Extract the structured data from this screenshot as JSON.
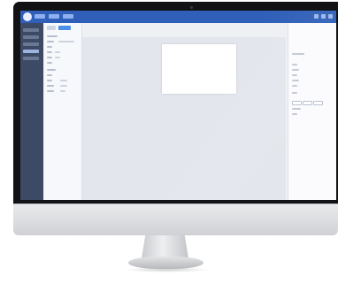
{
  "window": {
    "title": "",
    "tabs": [
      {
        "label": ""
      },
      {
        "label": ""
      },
      {
        "label": ""
      }
    ]
  },
  "sidebar": {
    "items": [
      {
        "label": ""
      },
      {
        "label": ""
      },
      {
        "label": ""
      },
      {
        "label": ""
      },
      {
        "label": ""
      }
    ]
  },
  "canvas": {
    "zoom": ""
  },
  "colors": {
    "accent": "#2f5fb8",
    "sidebar_bg": "#3c4a66",
    "canvas_bg": "#e3e6ec",
    "page_bg": "#ffffff",
    "bezel": "#121214",
    "chin": "#e0e1e3"
  },
  "icons": [
    "app-logo-icon",
    "minimize-icon",
    "maximize-icon",
    "close-icon",
    "tool-icon"
  ]
}
